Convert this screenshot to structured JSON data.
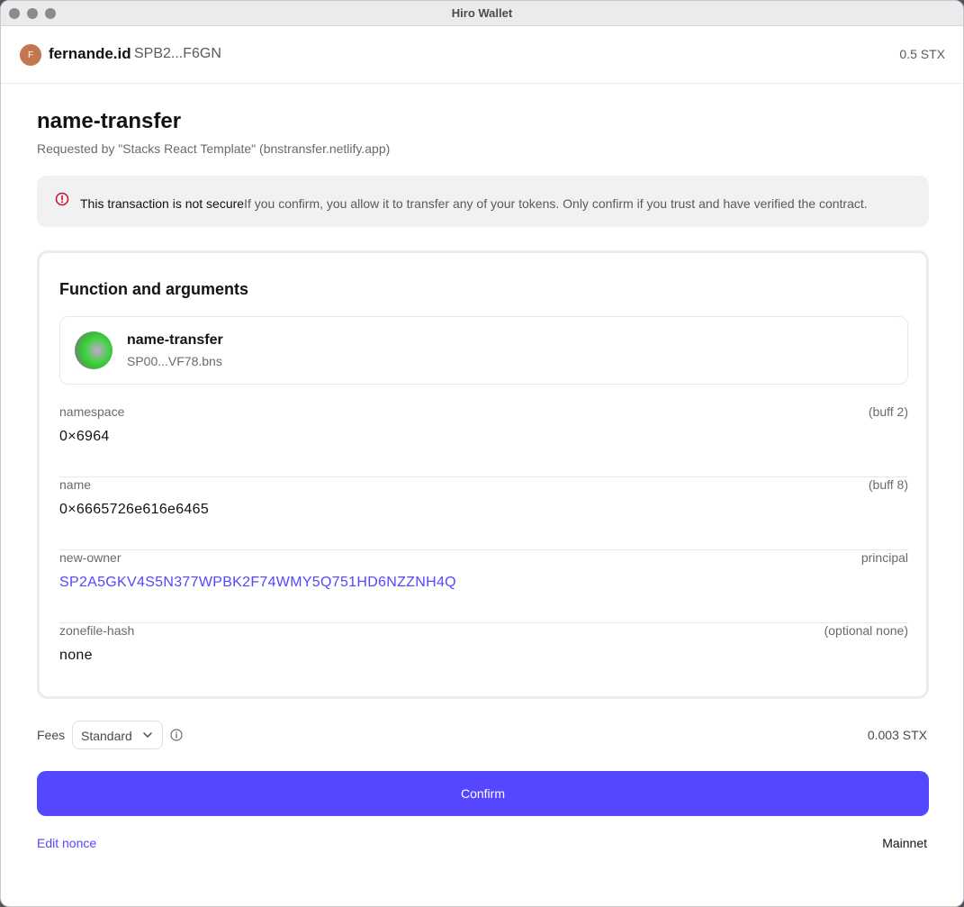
{
  "window": {
    "title": "Hiro Wallet"
  },
  "account": {
    "avatar_letter": "F",
    "name": "fernande.id",
    "address": "SPB2...F6GN",
    "balance": "0.5 STX"
  },
  "request": {
    "title": "name-transfer",
    "requested_by": "Requested by \"Stacks React Template\" (bnstransfer.netlify.app)"
  },
  "warning": {
    "icon": "alert-circle-icon",
    "heading": "This transaction is not secure",
    "body": "If you confirm, you allow it to transfer any of your tokens. Only confirm if you trust and have verified the contract.",
    "color": "#c8102e"
  },
  "function_card": {
    "title": "Function and arguments",
    "contract": {
      "function_name": "name-transfer",
      "contract_id": "SP00...VF78.bns"
    },
    "arguments": [
      {
        "name": "namespace",
        "type": "(buff 2)",
        "value": "0×6964"
      },
      {
        "name": "name",
        "type": "(buff 8)",
        "value": "0×6665726e616e6465"
      },
      {
        "name": "new-owner",
        "type": "principal",
        "value": "SP2A5GKV4S5N377WPBK2F74WMY5Q751HD6NZZNH4Q"
      },
      {
        "name": "zonefile-hash",
        "type": "(optional none)",
        "value": "none"
      }
    ]
  },
  "fees": {
    "label": "Fees",
    "selected": "Standard",
    "amount": "0.003 STX"
  },
  "actions": {
    "confirm_label": "Confirm",
    "edit_nonce_label": "Edit nonce",
    "network": "Mainnet"
  },
  "colors": {
    "accent": "#5546ff",
    "muted_text": "#6a6a6a",
    "border": "#e8e8e8"
  }
}
